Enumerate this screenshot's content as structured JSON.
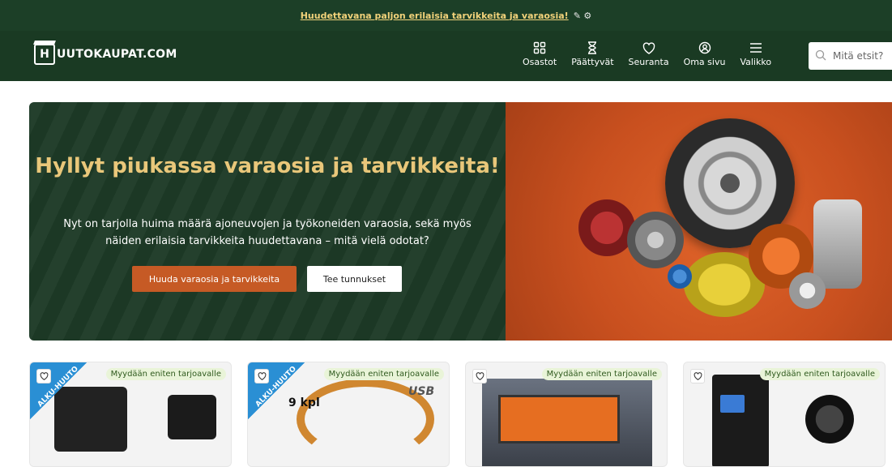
{
  "topbar": {
    "link": "Huudettavana paljon erilaisia tarvikkeita ja varaosia!",
    "symbols": "✎ ⚙"
  },
  "header": {
    "logo_letter": "H",
    "logo_text": "UUTOKAUPAT.COM",
    "nav": [
      {
        "label": "Osastot",
        "icon": "grid-icon"
      },
      {
        "label": "Päättyvät",
        "icon": "hourglass-icon"
      },
      {
        "label": "Seuranta",
        "icon": "heart-icon"
      },
      {
        "label": "Oma sivu",
        "icon": "user-icon"
      },
      {
        "label": "Valikko",
        "icon": "menu-icon"
      }
    ],
    "search_placeholder": "Mitä etsit?"
  },
  "hero": {
    "title": "Hyllyt piukassa varaosia ja tarvikkeita!",
    "subtitle": "Nyt on tarjolla huima määrä ajoneuvojen ja työkoneiden varaosia, sekä myös näiden erilaisia tarvikkeita huudettavana – mitä vielä odotat?",
    "primary_button": "Huuda varaosia ja tarvikkeita",
    "secondary_button": "Tee tunnukset"
  },
  "cards": [
    {
      "badge": "Myydään eniten tarjoavalle",
      "ribbon": "ALKU-HUUTO"
    },
    {
      "badge": "Myydään eniten tarjoavalle",
      "ribbon": "ALKU-HUUTO",
      "text": "9 kpl",
      "usb": "USB"
    },
    {
      "badge": "Myydään eniten tarjoavalle"
    },
    {
      "badge": "Myydään eniten tarjoavalle"
    }
  ],
  "colors": {
    "brand_green": "#1a3a23",
    "accent_orange": "#c65a25",
    "hero_title": "#e9c77a"
  }
}
